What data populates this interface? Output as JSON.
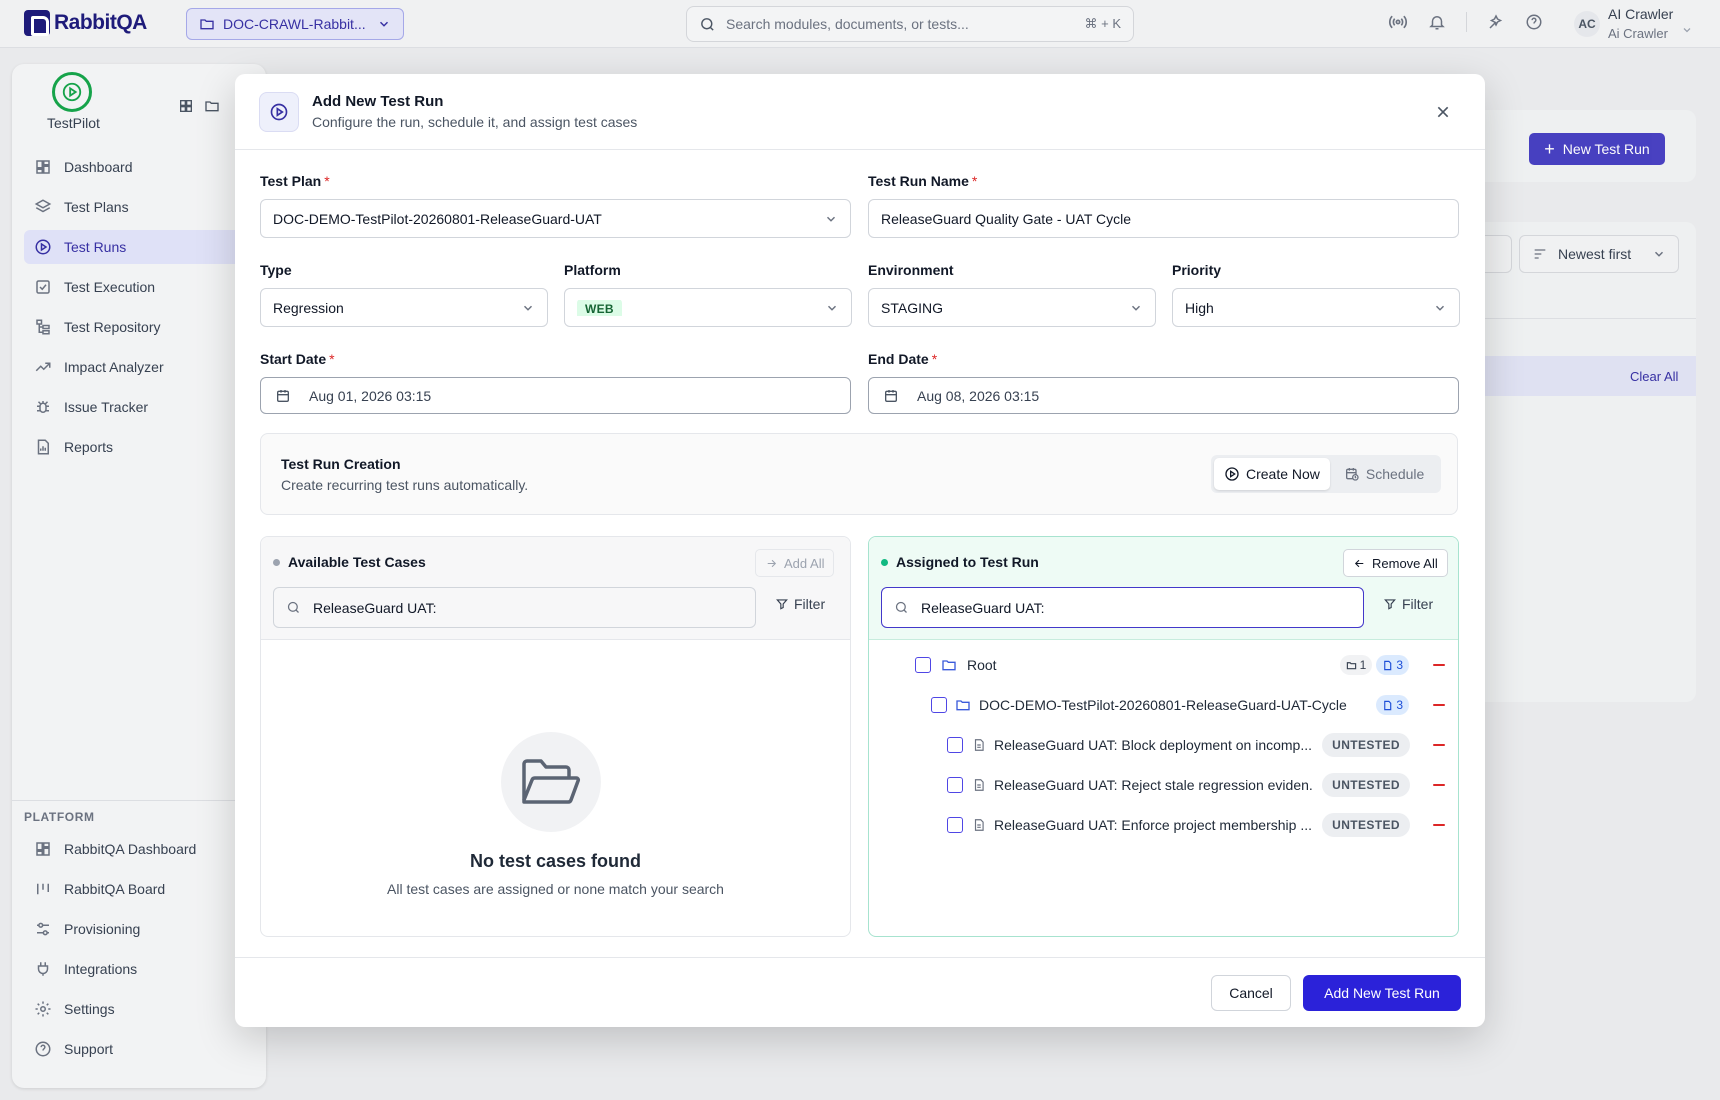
{
  "app": {
    "logo_text": "RabbitQA",
    "project_selector": "DOC-CRAWL-Rabbit...",
    "search_placeholder": "Search modules, documents, or tests...",
    "search_shortcut": "⌘ + K",
    "user_initials": "AC",
    "user_name": "AI Crawler",
    "user_sub": "Ai Crawler"
  },
  "sidebar": {
    "module_name": "TestPilot",
    "items": [
      {
        "label": "Dashboard",
        "icon": "dashboard-icon"
      },
      {
        "label": "Test Plans",
        "icon": "layers-icon"
      },
      {
        "label": "Test Runs",
        "icon": "play-circle-icon",
        "active": true
      },
      {
        "label": "Test Execution",
        "icon": "checkbox-icon"
      },
      {
        "label": "Test Repository",
        "icon": "tree-icon"
      },
      {
        "label": "Impact Analyzer",
        "icon": "trend-icon"
      },
      {
        "label": "Issue Tracker",
        "icon": "bug-icon"
      },
      {
        "label": "Reports",
        "icon": "report-icon"
      }
    ],
    "section_label": "PLATFORM",
    "platform_items": [
      {
        "label": "RabbitQA Dashboard",
        "icon": "dashboard-icon"
      },
      {
        "label": "RabbitQA Board",
        "icon": "board-icon"
      },
      {
        "label": "Provisioning",
        "icon": "sliders-icon"
      },
      {
        "label": "Integrations",
        "icon": "plug-icon"
      },
      {
        "label": "Settings",
        "icon": "gear-icon"
      },
      {
        "label": "Support",
        "icon": "help-icon"
      }
    ]
  },
  "background": {
    "new_test_run_button": "New Test Run",
    "sort_label": "Newest first",
    "clear_all": "Clear All"
  },
  "modal": {
    "title": "Add New Test Run",
    "subtitle": "Configure the run, schedule it, and assign test cases",
    "fields": {
      "test_plan_label": "Test Plan",
      "test_plan_value": "DOC-DEMO-TestPilot-20260801-ReleaseGuard-UAT",
      "run_name_label": "Test Run Name",
      "run_name_value": "ReleaseGuard Quality Gate - UAT Cycle",
      "type_label": "Type",
      "type_value": "Regression",
      "platform_label": "Platform",
      "platform_value": "WEB",
      "environment_label": "Environment",
      "environment_value": "STAGING",
      "priority_label": "Priority",
      "priority_value": "High",
      "start_date_label": "Start Date",
      "start_date_value": "Aug 01, 2026 03:15",
      "end_date_label": "End Date",
      "end_date_value": "Aug 08, 2026 03:15",
      "required_mark": "*"
    },
    "creation": {
      "title": "Test Run Creation",
      "subtitle": "Create recurring test runs automatically.",
      "create_now": "Create Now",
      "schedule": "Schedule"
    },
    "available": {
      "title": "Available Test Cases",
      "add_all": "Add All",
      "search_value": "ReleaseGuard UAT:",
      "filter": "Filter",
      "empty_title": "No test cases found",
      "empty_sub": "All test cases are assigned or none match your search"
    },
    "assigned": {
      "title": "Assigned to Test Run",
      "remove_all": "Remove All",
      "search_value": "ReleaseGuard UAT:",
      "filter": "Filter",
      "root_label": "Root",
      "root_folder_count": "1",
      "root_case_count": "3",
      "folder_label": "DOC-DEMO-TestPilot-20260801-ReleaseGuard-UAT-Cycle",
      "folder_case_count": "3",
      "cases": [
        {
          "title": "ReleaseGuard UAT: Block deployment on incomp...",
          "status": "UNTESTED"
        },
        {
          "title": "ReleaseGuard UAT: Reject stale regression eviden...",
          "status": "UNTESTED"
        },
        {
          "title": "ReleaseGuard UAT: Enforce project membership ...",
          "status": "UNTESTED"
        }
      ]
    },
    "footer": {
      "cancel": "Cancel",
      "submit": "Add New Test Run"
    }
  },
  "colors": {
    "primary": "#2b22d9",
    "success": "#10b981",
    "danger": "#dc2626"
  }
}
